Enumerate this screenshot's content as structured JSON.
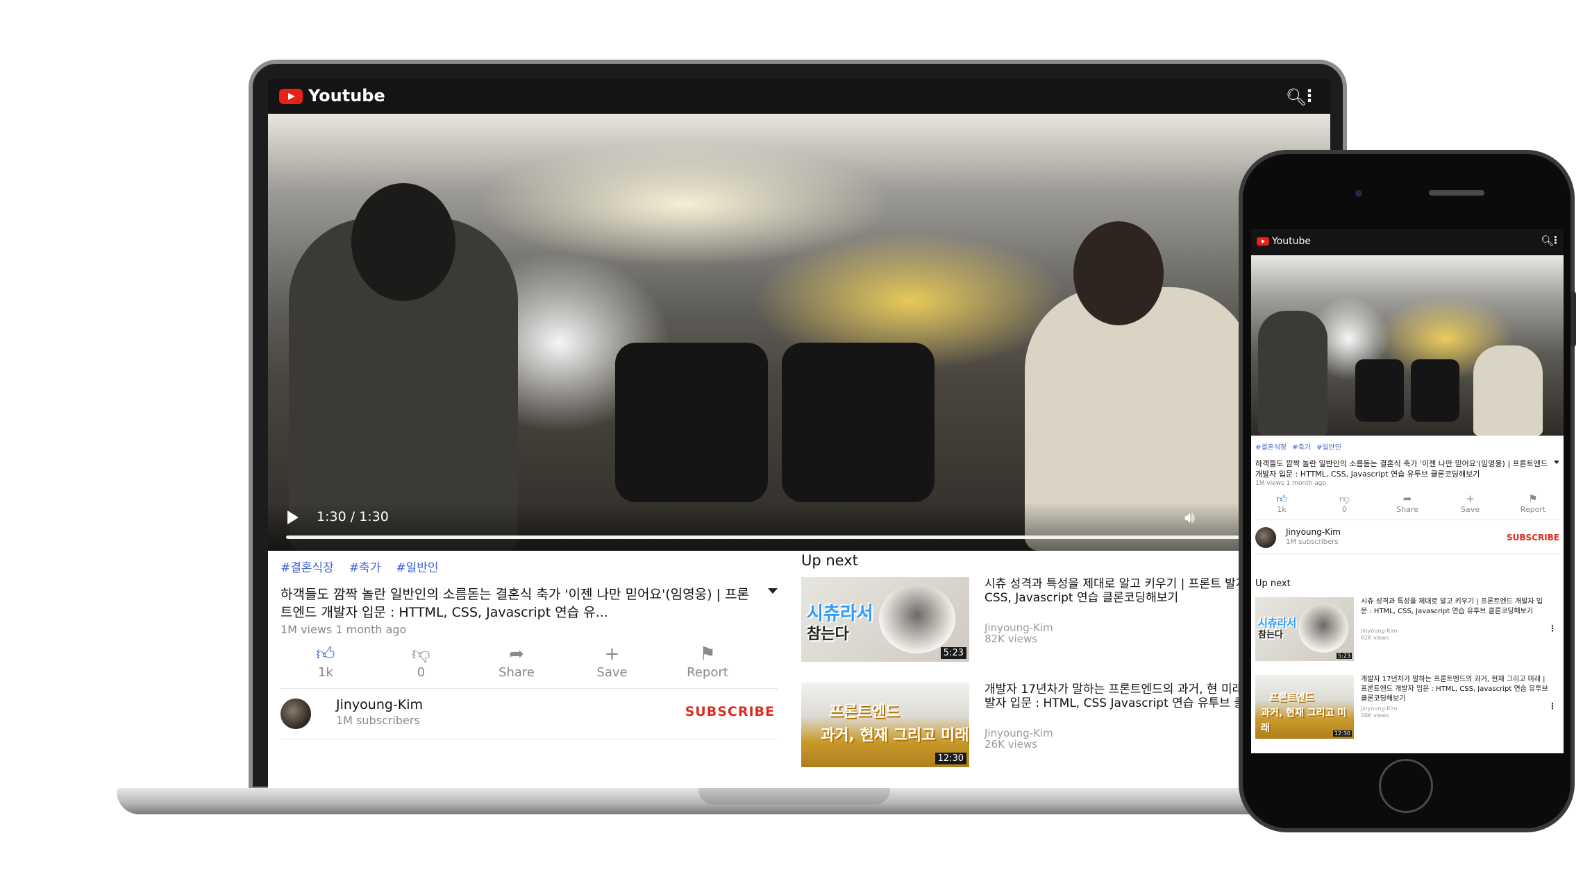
{
  "app": {
    "brand": "Youtube"
  },
  "video": {
    "time": "1:30 / 1:30",
    "tags": [
      "#결혼식장",
      "#축가",
      "#일반인"
    ],
    "title": "하객들도 깜짝 놀란 일반인의 소름돋는 결혼식 축가 '이젠 나만 믿어요'(임영웅) | 프론트엔드 개발자 입문 : HTTML, CSS, Javascript 연습 유...",
    "title_full": "하객들도 깜짝 놀란 일반인의 소름돋는 결혼식 축가 '이젠 나만 믿어요'(임영웅) | 프론트엔드 개발자 입문 : HTTML, CSS, Javascript 연습 유투브 클론코딩해보기",
    "meta": "1M views 1 month ago",
    "progress": 1.0
  },
  "actions": [
    {
      "label": "1k",
      "icon": "thumbs-up-icon"
    },
    {
      "label": "0",
      "icon": "thumbs-down-icon"
    },
    {
      "label": "Share",
      "icon": "share-icon"
    },
    {
      "label": "Save",
      "icon": "plus-icon"
    },
    {
      "label": "Report",
      "icon": "flag-icon"
    }
  ],
  "channel": {
    "name": "Jinyoung-Kim",
    "subscribers": "1M subscribers",
    "subscribe_label": "SUBSCRIBE"
  },
  "upnext": {
    "label": "Up next",
    "items": [
      {
        "thumb_text_1": "시츄라서",
        "thumb_text_2": "참는다",
        "duration": "5:23",
        "title": "시츄 성격과 특성을 제대로 알고 키우기 | 프론트엔드 개발자 입문 : HTML, CSS, Javascript 연습 유투브 클론코딩해보기",
        "laptop_title": "시츄 성격과 특성을 제대로 알고 키우기 | 프론트 발자 입문 : HTML, CSS, Javascript 연습 클론코딩해보기",
        "channel": "Jinyoung-Kim",
        "views": "82K views"
      },
      {
        "thumb_text_1": "프론트엔드",
        "thumb_text_2": "과거, 현재 그리고 미래",
        "duration": "12:30",
        "title": "개발자 17년차가 말하는 프론트엔드의 과거, 현재 그리고 미래 | 프론트엔드 개발자 입문 : HTML, CSS, Javascript 연습 유투브 클론코딩해보기",
        "laptop_title": "개발자 17년차가 말하는 프론트엔드의 과거, 현 미래 | 프론트엔드 개발자 입문 : HTML, CSS Javascript 연습 유투브 클론코딩해보기",
        "channel": "Jinyoung-Kim",
        "views": "26K views"
      }
    ]
  },
  "colors": {
    "brand_red": "#e62117",
    "subscribe_red": "#e02a1f",
    "tag_blue": "#3d63d4",
    "header_bg": "#141414"
  }
}
